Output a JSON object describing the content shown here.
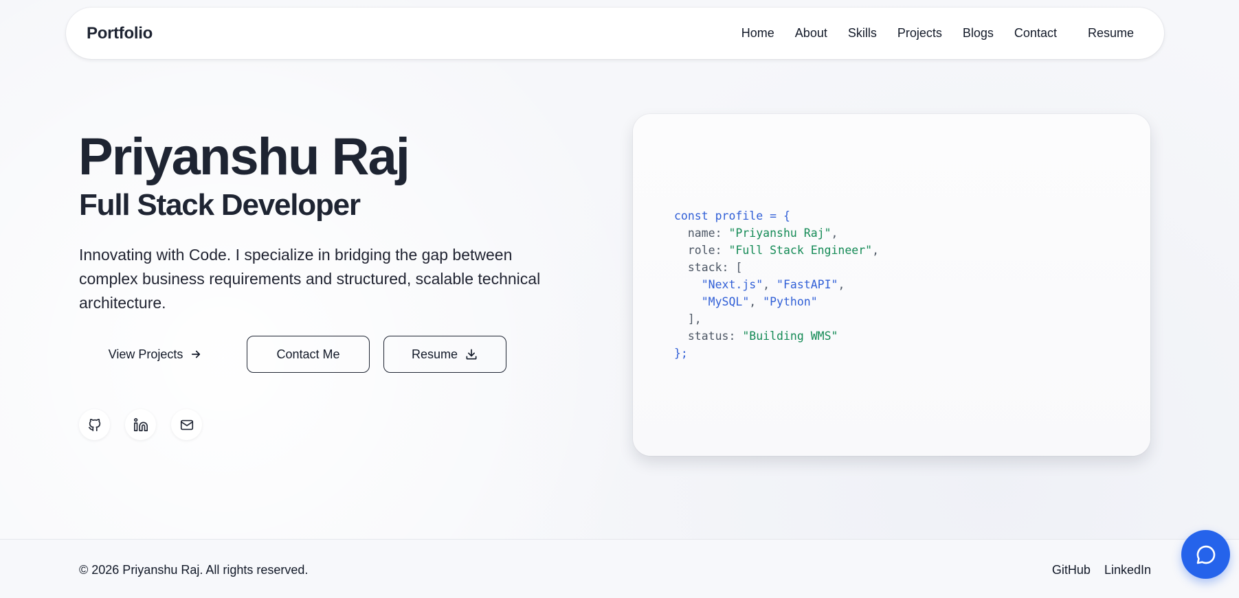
{
  "nav": {
    "brand": "Portfolio",
    "links": [
      "Home",
      "About",
      "Skills",
      "Projects",
      "Blogs",
      "Contact"
    ],
    "resume": "Resume"
  },
  "hero": {
    "name": "Priyanshu Raj",
    "role": "Full Stack Developer",
    "description": "Innovating with Code. I specialize in bridging the gap between complex business requirements and structured, scalable technical architecture.",
    "buttons": {
      "view_projects": "View Projects",
      "contact": "Contact Me",
      "resume": "Resume"
    },
    "socials": [
      "github-icon",
      "linkedin-icon",
      "mail-icon"
    ]
  },
  "code": {
    "line1": "const profile = {",
    "name_key": "name: ",
    "name_val": "\"Priyanshu Raj\"",
    "role_key": "role: ",
    "role_val": "\"Full Stack Engineer\"",
    "stack_key": "stack: [",
    "stack_1": "\"Next.js\"",
    "stack_2": "\"FastAPI\"",
    "stack_3": "\"MySQL\"",
    "stack_4": "\"Python\"",
    "stack_close": "],",
    "status_key": "status: ",
    "status_val": "\"Building WMS\"",
    "close": "};"
  },
  "footer": {
    "copyright": "© 2026 Priyanshu Raj. All rights reserved.",
    "links": [
      "GitHub",
      "LinkedIn"
    ]
  },
  "colors": {
    "accent": "#2563eb",
    "code_keyword": "#2f5ed6",
    "code_string": "#148a55",
    "text": "#1e2432"
  }
}
